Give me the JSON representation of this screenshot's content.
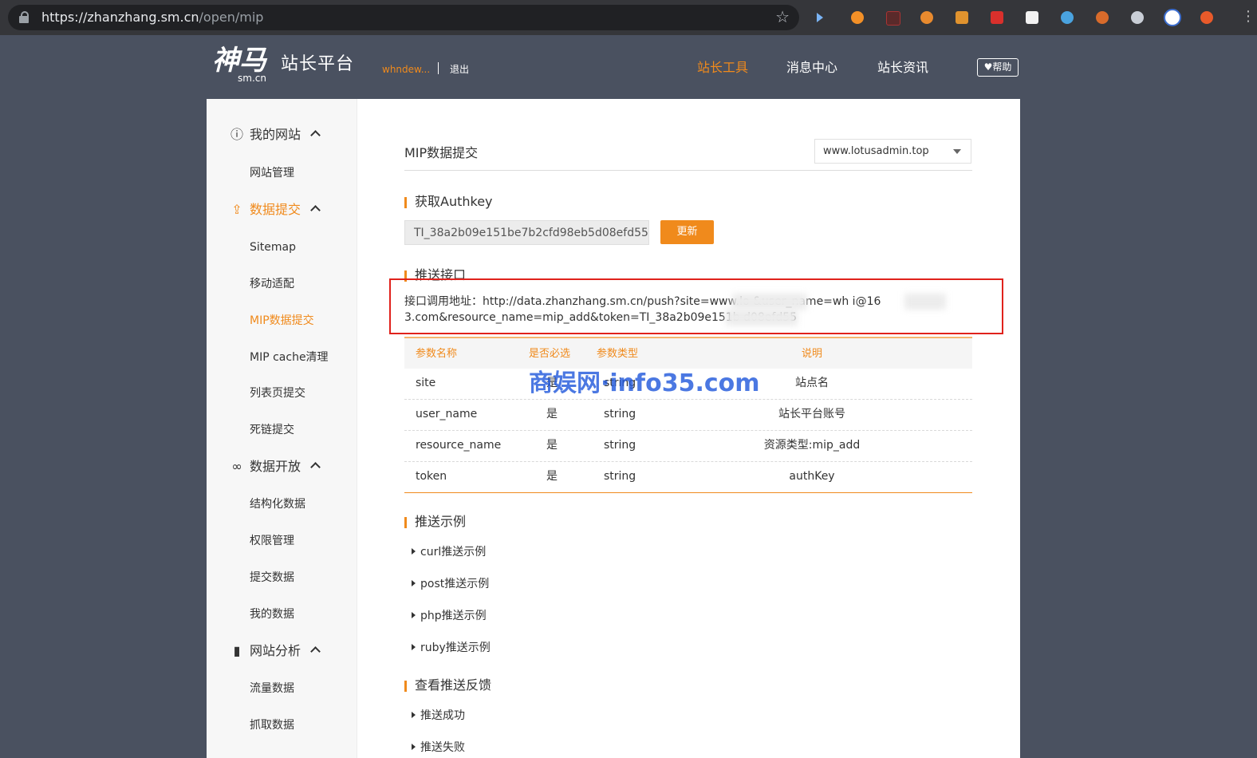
{
  "browser": {
    "url_host": "https://zhanzhang.sm.cn",
    "url_path": "/open/mip",
    "menu": "⋮"
  },
  "header": {
    "logo_mark": "神马",
    "logo_sub": "sm.cn",
    "logo_name": "站长平台",
    "username": "whndew...",
    "logout": "退出",
    "nav": [
      "站长工具",
      "消息中心",
      "站长资讯"
    ],
    "help": "帮助"
  },
  "sidebar": {
    "sections": [
      {
        "label": "我的网站",
        "items": [
          "网站管理"
        ]
      },
      {
        "label": "数据提交",
        "items": [
          "Sitemap",
          "移动适配",
          "MIP数据提交",
          "MIP cache清理",
          "列表页提交",
          "死链提交"
        ]
      },
      {
        "label": "数据开放",
        "items": [
          "结构化数据",
          "权限管理",
          "提交数据",
          "我的数据"
        ]
      },
      {
        "label": "网站分析",
        "items": [
          "流量数据",
          "抓取数据"
        ]
      }
    ],
    "active_item": "MIP数据提交"
  },
  "content": {
    "page_title": "MIP数据提交",
    "site_select": "www.lotusadmin.top",
    "authkey_heading": "获取Authkey",
    "authkey_value": "TI_38a2b09e151be7b2cfd98eb5d08efd55",
    "update_button": "更新",
    "push_heading": "推送接口",
    "api_line1": "接口调用地址：http://data.zhanzhang.sm.cn/push?site=www.lo                  &user_name=wh            i@16",
    "api_line2": "3.com&resource_name=mip_add&token=TI_38a2b09e151b                  d08efd55",
    "table": {
      "headers": [
        "参数名称",
        "是否必选",
        "参数类型",
        "说明"
      ],
      "rows": [
        [
          "site",
          "是",
          "string",
          "站点名"
        ],
        [
          "user_name",
          "是",
          "string",
          "站长平台账号"
        ],
        [
          "resource_name",
          "是",
          "string",
          "资源类型:mip_add"
        ],
        [
          "token",
          "是",
          "string",
          "authKey"
        ]
      ]
    },
    "examples_heading": "推送示例",
    "examples": [
      "curl推送示例",
      "post推送示例",
      "php推送示例",
      "ruby推送示例"
    ],
    "feedback_heading": "查看推送反馈",
    "feedback": [
      "推送成功",
      "推送失败"
    ]
  },
  "watermark": "商娱网·info35.com",
  "colors": {
    "accent": "#f08a1c",
    "page_bg": "#4a5160",
    "highlight_box": "#e0221c"
  }
}
